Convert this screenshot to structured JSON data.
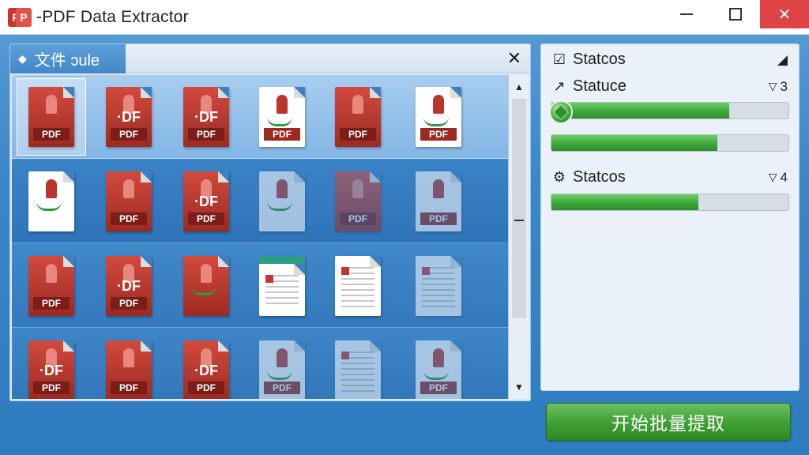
{
  "window": {
    "title": "-PDF Data Extractor",
    "app_icon": "pdf-app-icon"
  },
  "left_panel": {
    "tab_label": "文件 ɔule",
    "close_label": "✕",
    "tile_label": "PDF",
    "tile_big": "·DF"
  },
  "right_panel": {
    "section1": {
      "label": "Statcos",
      "icon": "edit-check-icon"
    },
    "section2": {
      "label": "Statuce",
      "icon": "arrow-up-right-icon",
      "count": "3",
      "progress": [
        0.75,
        0.7
      ]
    },
    "section3": {
      "label": "Statcos",
      "icon": "gear-icon",
      "count": "4",
      "progress": [
        0.62
      ]
    }
  },
  "actions": {
    "start_button": "开始批量提取"
  },
  "colors": {
    "accent": "#3a86c8",
    "progress_green": "#3fa63a",
    "close_red": "#e04343",
    "pdf_red": "#c8372d"
  }
}
